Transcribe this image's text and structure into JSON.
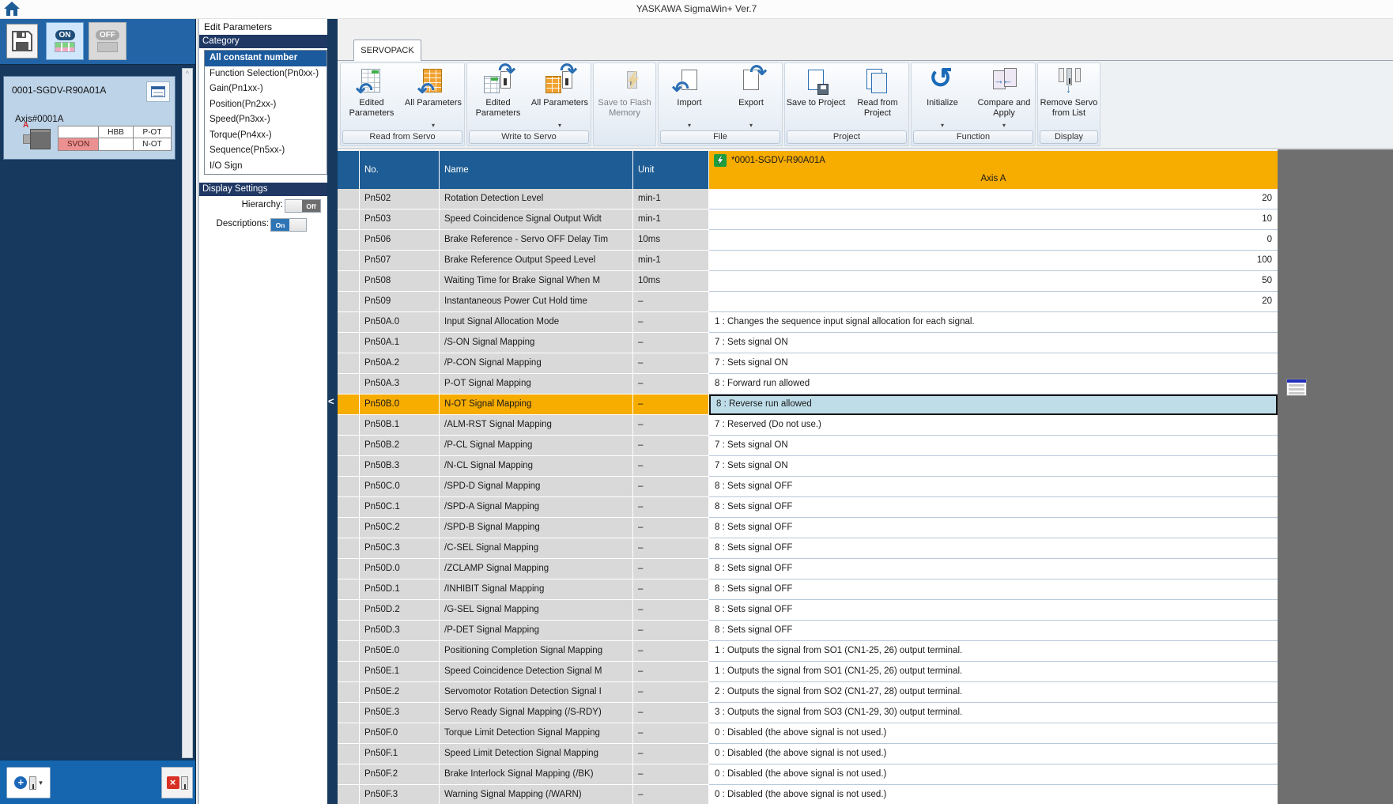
{
  "window": {
    "title": "YASKAWA SigmaWin+ Ver.7"
  },
  "colors": {
    "accent_orange": "#F7AC00",
    "table_header_blue": "#1D5C94",
    "panel_navy": "#16395D",
    "toolbar_blue": "#2264A6",
    "selected_cell_blue": "#BEDDE8",
    "status_active_red": "#EC9191",
    "category_selected_blue": "#1C5A9E"
  },
  "left_panel": {
    "toolbar": {
      "save_icon": "floppy-disk-icon",
      "on_label": "ON",
      "off_label": "OFF"
    },
    "device": {
      "name": "0001-SGDV-R90A01A",
      "axis": "Axis#0001A",
      "axis_letter": "A",
      "status": {
        "hbb": "HBB",
        "p_ot": "P-OT",
        "svon": "SVON",
        "n_ot": "N-OT"
      }
    },
    "bottom": {
      "add_servo_icon": "plus-circle-icon",
      "remove_servo_icon": "red-x-icon"
    }
  },
  "edit_panel": {
    "title": "Edit Parameters",
    "category_header": "Category",
    "selected_category": "All constant number",
    "categories": [
      "All constant number",
      "Function Selection(Pn0xx-)",
      "Gain(Pn1xx-)",
      "Position(Pn2xx-)",
      "Speed(Pn3xx-)",
      "Torque(Pn4xx-)",
      "Sequence(Pn5xx-)",
      "I/O Sign"
    ],
    "display_settings": {
      "header": "Display Settings",
      "hierarchy_label": "Hierarchy:",
      "hierarchy_value": "Off",
      "descriptions_label": "Descriptions:",
      "descriptions_value": "On"
    }
  },
  "ribbon": {
    "tab": "SERVOPACK",
    "groups": [
      {
        "label": "Read from Servo",
        "buttons": [
          {
            "label": "Edited Parameters",
            "icon": "read-edited",
            "dropdown": false,
            "disabled": false
          },
          {
            "label": "All Parameters",
            "icon": "read-all",
            "dropdown": true,
            "disabled": false
          }
        ]
      },
      {
        "label": "Write to Servo",
        "buttons": [
          {
            "label": "Edited Parameters",
            "icon": "write-edited",
            "dropdown": false,
            "disabled": false
          },
          {
            "label": "All Parameters",
            "icon": "write-all",
            "dropdown": true,
            "disabled": false
          }
        ]
      },
      {
        "label": "",
        "buttons": [
          {
            "label": "Save to Flash Memory",
            "icon": "flash",
            "dropdown": false,
            "disabled": true
          }
        ]
      },
      {
        "label": "File",
        "buttons": [
          {
            "label": "Import",
            "icon": "import",
            "dropdown": true,
            "disabled": false
          },
          {
            "label": "Export",
            "icon": "export",
            "dropdown": true,
            "disabled": false
          }
        ]
      },
      {
        "label": "Project",
        "buttons": [
          {
            "label": "Save to Project",
            "icon": "save-project",
            "dropdown": false,
            "disabled": false
          },
          {
            "label": "Read from Project",
            "icon": "read-project",
            "dropdown": false,
            "disabled": false
          }
        ]
      },
      {
        "label": "Function",
        "buttons": [
          {
            "label": "Initialize",
            "icon": "initialize",
            "dropdown": true,
            "disabled": false
          },
          {
            "label": "Compare and Apply",
            "icon": "compare",
            "dropdown": true,
            "disabled": false
          }
        ]
      },
      {
        "label": "Display",
        "buttons": [
          {
            "label": "Remove Servo from List",
            "icon": "remove-servo",
            "dropdown": false,
            "disabled": false
          }
        ]
      }
    ]
  },
  "table": {
    "columns": [
      "No.",
      "Name",
      "Unit"
    ],
    "value_header": {
      "device": "*0001-SGDV-R90A01A",
      "axis": "Axis A",
      "icon": "green-lightning-icon"
    },
    "rows": [
      {
        "no": "Pn502",
        "name": "Rotation Detection Level",
        "unit": "min-1",
        "value": "20",
        "align": "right",
        "selected": false
      },
      {
        "no": "Pn503",
        "name": "Speed Coincidence Signal Output Widt",
        "unit": "min-1",
        "value": "10",
        "align": "right",
        "selected": false
      },
      {
        "no": "Pn506",
        "name": "Brake Reference - Servo OFF Delay Tim",
        "unit": "10ms",
        "value": "0",
        "align": "right",
        "selected": false
      },
      {
        "no": "Pn507",
        "name": "Brake Reference Output Speed Level",
        "unit": "min-1",
        "value": "100",
        "align": "right",
        "selected": false
      },
      {
        "no": "Pn508",
        "name": "Waiting Time for Brake Signal When M",
        "unit": "10ms",
        "value": "50",
        "align": "right",
        "selected": false
      },
      {
        "no": "Pn509",
        "name": "Instantaneous Power Cut Hold time",
        "unit": "–",
        "value": "20",
        "align": "right",
        "selected": false
      },
      {
        "no": "Pn50A.0",
        "name": "Input Signal Allocation Mode",
        "unit": "–",
        "value": "1 : Changes the sequence input signal allocation for each signal.",
        "align": "left",
        "selected": false
      },
      {
        "no": "Pn50A.1",
        "name": "/S-ON Signal Mapping",
        "unit": "–",
        "value": "7 : Sets signal ON",
        "align": "left",
        "selected": false
      },
      {
        "no": "Pn50A.2",
        "name": "/P-CON Signal Mapping",
        "unit": "–",
        "value": "7 : Sets signal ON",
        "align": "left",
        "selected": false
      },
      {
        "no": "Pn50A.3",
        "name": "P-OT Signal Mapping",
        "unit": "–",
        "value": "8 : Forward run allowed",
        "align": "left",
        "selected": false
      },
      {
        "no": "Pn50B.0",
        "name": "N-OT Signal Mapping",
        "unit": "–",
        "value": "8 : Reverse run allowed",
        "align": "left",
        "selected": true
      },
      {
        "no": "Pn50B.1",
        "name": "/ALM-RST Signal Mapping",
        "unit": "–",
        "value": "7 : Reserved (Do not use.)",
        "align": "left",
        "selected": false
      },
      {
        "no": "Pn50B.2",
        "name": "/P-CL Signal Mapping",
        "unit": "–",
        "value": "7 : Sets signal ON",
        "align": "left",
        "selected": false
      },
      {
        "no": "Pn50B.3",
        "name": "/N-CL Signal Mapping",
        "unit": "–",
        "value": "7 : Sets signal ON",
        "align": "left",
        "selected": false
      },
      {
        "no": "Pn50C.0",
        "name": "/SPD-D Signal Mapping",
        "unit": "–",
        "value": "8 : Sets signal OFF",
        "align": "left",
        "selected": false
      },
      {
        "no": "Pn50C.1",
        "name": "/SPD-A Signal Mapping",
        "unit": "–",
        "value": "8 : Sets signal OFF",
        "align": "left",
        "selected": false
      },
      {
        "no": "Pn50C.2",
        "name": "/SPD-B Signal Mapping",
        "unit": "–",
        "value": "8 : Sets signal OFF",
        "align": "left",
        "selected": false
      },
      {
        "no": "Pn50C.3",
        "name": "/C-SEL Signal Mapping",
        "unit": "–",
        "value": "8 : Sets signal OFF",
        "align": "left",
        "selected": false
      },
      {
        "no": "Pn50D.0",
        "name": "/ZCLAMP Signal Mapping",
        "unit": "–",
        "value": "8 : Sets signal OFF",
        "align": "left",
        "selected": false
      },
      {
        "no": "Pn50D.1",
        "name": "/INHIBIT Signal Mapping",
        "unit": "–",
        "value": "8 : Sets signal OFF",
        "align": "left",
        "selected": false
      },
      {
        "no": "Pn50D.2",
        "name": "/G-SEL Signal Mapping",
        "unit": "–",
        "value": "8 : Sets signal OFF",
        "align": "left",
        "selected": false
      },
      {
        "no": "Pn50D.3",
        "name": "/P-DET Signal Mapping",
        "unit": "–",
        "value": "8 : Sets signal OFF",
        "align": "left",
        "selected": false
      },
      {
        "no": "Pn50E.0",
        "name": "Positioning Completion Signal Mapping",
        "unit": "–",
        "value": "1 : Outputs the signal from SO1 (CN1-25, 26) output terminal.",
        "align": "left",
        "selected": false
      },
      {
        "no": "Pn50E.1",
        "name": "Speed Coincidence Detection Signal M",
        "unit": "–",
        "value": "1 : Outputs the signal from SO1 (CN1-25, 26) output terminal.",
        "align": "left",
        "selected": false
      },
      {
        "no": "Pn50E.2",
        "name": "Servomotor Rotation Detection Signal I",
        "unit": "–",
        "value": "2 : Outputs the signal from SO2 (CN1-27, 28) output terminal.",
        "align": "left",
        "selected": false
      },
      {
        "no": "Pn50E.3",
        "name": "Servo Ready Signal Mapping (/S-RDY)",
        "unit": "–",
        "value": "3 : Outputs the signal from SO3 (CN1-29, 30) output terminal.",
        "align": "left",
        "selected": false
      },
      {
        "no": "Pn50F.0",
        "name": "Torque Limit Detection Signal Mapping",
        "unit": "–",
        "value": "0 : Disabled (the above signal is not used.)",
        "align": "left",
        "selected": false
      },
      {
        "no": "Pn50F.1",
        "name": "Speed Limit Detection Signal Mapping",
        "unit": "–",
        "value": "0 : Disabled (the above signal is not used.)",
        "align": "left",
        "selected": false
      },
      {
        "no": "Pn50F.2",
        "name": "Brake Interlock Signal Mapping (/BK)",
        "unit": "–",
        "value": "0 : Disabled (the above signal is not used.)",
        "align": "left",
        "selected": false
      },
      {
        "no": "Pn50F.3",
        "name": "Warning Signal Mapping (/WARN)",
        "unit": "–",
        "value": "0 : Disabled (the above signal is not used.)",
        "align": "left",
        "selected": false
      }
    ]
  }
}
